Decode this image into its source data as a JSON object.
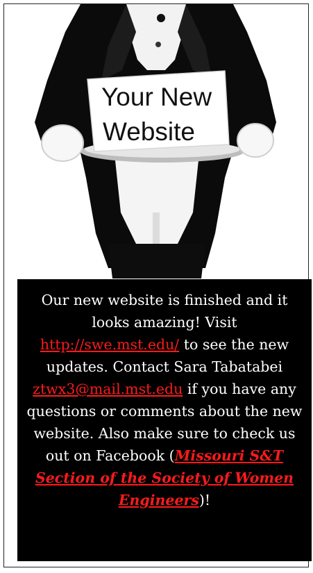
{
  "hero": {
    "image_icon": "waiter-holding-silver-tray-with-sign",
    "sign_line1": "Your New",
    "sign_line2": "Website"
  },
  "announcement": {
    "text_1": "Our new website is finished and it looks amazing!  Visit",
    "link_site": "http://swe.mst.edu/",
    "text_2": "to see the new updates.  Contact Sara Tabatabei",
    "link_email": "ztwx3@mail.mst.edu",
    "text_3": "if you have any questions or comments about the new website.  Also make sure to check us out on Facebook (",
    "link_facebook": "Missouri S&T Section of the Society of Women Engineers",
    "text_4": ")!"
  },
  "colors": {
    "panel_background": "#000000",
    "panel_text": "#ffffff",
    "link": "#ff1a1a"
  }
}
